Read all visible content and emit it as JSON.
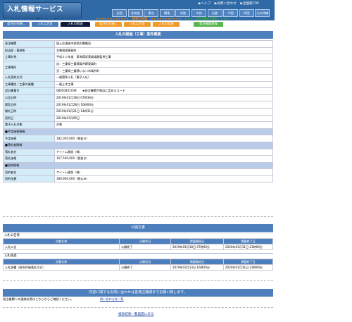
{
  "header": {
    "logo": "入札情報サービス",
    "util_links": [
      "▶ヘルプ",
      "▶お問い合わせ",
      "▶全国版TOP"
    ],
    "regions": [
      "全国",
      "北海道",
      "東北",
      "関東",
      "北陸",
      "中部",
      "近畿",
      "中国",
      "四国",
      "九州沖縄"
    ]
  },
  "categories": {
    "construction": "★★★★★★★★★★★　工事の検索　★★★★★★★★★★★",
    "service": "★★★★★★★★★★★★　業務の検索　★★★★★★★★★★★",
    "ordering_org": "★★★　発注機関の検索　★★★"
  },
  "tabs": [
    {
      "label": "発注の見通し",
      "color": "blue"
    },
    {
      "label": "入札公告等",
      "color": "blue"
    },
    {
      "label": "入札の経過",
      "color": "active"
    },
    {
      "label": "発注の見通し",
      "color": "orange"
    },
    {
      "label": "入札公告等",
      "color": "orange"
    },
    {
      "label": "入札の経過",
      "color": "orange"
    },
    {
      "label": "発注機関情報",
      "color": "green"
    }
  ],
  "page_title": "入札の経過（工事）案件概要",
  "rows": [
    {
      "label": "発注機関",
      "value": "国土交通省中部地方整備局"
    },
    {
      "label": "担当部・事務所",
      "value": "北勢国道事務所"
    },
    {
      "label": "工事名称",
      "value": "平成２０年度　東海環状東員道路監視工事"
    },
    {
      "label": "工事場所",
      "value": "自：三重県三重郡員弁郡東員町"
    },
    {
      "label": "",
      "value": "至：三重県三重郡いなべ市員弁町"
    },
    {
      "label": "入札契約方式",
      "value": "一般競争入札（電子入札）"
    },
    {
      "label": "工事種別／工事の業種",
      "value": "一般土木工事"
    },
    {
      "label": "設計書番号",
      "value": "08050401039　　★発注機関が独自に定めるコード"
    },
    {
      "label": "公告日時",
      "value": "2019年01月18日 07時30分"
    },
    {
      "label": "閲覧日時",
      "value": "2019年01月28日 10時00分"
    },
    {
      "label": "開札日時",
      "value": "2019年01月21日 14時31分"
    },
    {
      "label": "契約日",
      "value": "2019年03月06日"
    },
    {
      "label": "電子入札対象",
      "value": "対象"
    }
  ],
  "sections": {
    "estimated_price": {
      "title": "■予定価格情報",
      "rows": [
        {
          "label": "予定価格",
          "value": "182,050,000（税抜き）"
        }
      ]
    },
    "winner": {
      "title": "■落札者情報",
      "rows": [
        {
          "label": "落札者名",
          "value": "アイトム建設（株）"
        },
        {
          "label": "落札価格",
          "value": "167,500,000（税抜き）"
        }
      ]
    },
    "contract": {
      "title": "■契約情報",
      "rows": [
        {
          "label": "契約者名",
          "value": "アイトム建設（株）"
        },
        {
          "label": "契約金額",
          "value": "180,900,000（税込み）"
        }
      ]
    }
  },
  "public_docs": {
    "title": "公開文書",
    "groups": [
      {
        "heading": "入札公告等",
        "columns": [
          "文書名称",
          "公開状況",
          "掲載開始日",
          "掲載終了日"
        ],
        "rows": [
          [
            "入札公告",
            "公開終了",
            "2019年01月18日 07時00分",
            "2020年01月31日 23時00分"
          ]
        ]
      },
      {
        "heading": "入札経過",
        "columns": [
          "文書名称",
          "公開状況",
          "掲載開始日",
          "掲載終了日"
        ],
        "rows": [
          [
            "入札調書（総合評価落札方式）",
            "公開終了",
            "2019年03月13日 16時26分",
            "2020年01月31日 23時00分"
          ]
        ]
      }
    ]
  },
  "contact": {
    "bar": "内容に関するお問い合わせは各発注機関までお願い致します。",
    "line": "発注機関への連絡先等はこちらからご確認ください。",
    "link": "問い合わせ先一覧"
  },
  "back_link": "検索結果一覧画面に戻る"
}
